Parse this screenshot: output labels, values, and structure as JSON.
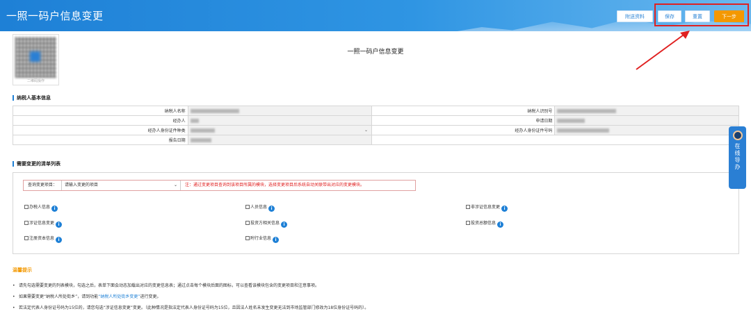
{
  "header": {
    "title": "一照一码户信息变更",
    "buttons": {
      "attach": "附送资料",
      "save": "保存",
      "reset": "重置",
      "next": "下一步"
    }
  },
  "qr": {
    "caption": "二维码操作"
  },
  "page_title": "一照一码户信息变更",
  "basic_info": {
    "section_title": "纳税人基本信息",
    "fields": {
      "taxpayer_name": "纳税人名称",
      "taxpayer_id": "纳税人识别号",
      "agent": "经办人",
      "apply_date": "申请日期",
      "agent_id_type": "经办人身份证件种类",
      "agent_id_number": "经办人身份证件号码",
      "report_date": "报告日期"
    }
  },
  "change_list": {
    "section_title": "需要变更的清单列表",
    "query_label": "查询变更项目：",
    "query_placeholder": "请输入变更的项目",
    "note": "注：通过变更项目查询到该项目所属的模块，选择变更项目后系统自动关联带出对应的变更模块。",
    "items": [
      "办税人信息",
      "人员信息",
      "非涉证信息变更",
      "涉证信息变更",
      "投资方相关信息",
      "投资总额信息",
      "注册资本信息",
      "附行业信息"
    ]
  },
  "tips": {
    "title": "温馨提示",
    "lines": [
      "请先勾选需要变更的列表模块，勾选之后，表单下面会动态加载出对应的变更信息表；通过点击每个模块后面的图标，可以查看该模块包含的变更项目和注意事项。",
      [
        "如果需要变更“纳税人所处街乡”，请到功能",
        "“纳税人所处街乡变更”",
        "进行变更。"
      ],
      "若法定代表人身份证号码为15位的，请您勾选“涉证信息变更”变更。（此种情况是指法定代表人身份证号码为15位，且因法人姓名未发生变更无法到市场监管部门修改为18位身份证号码的）。"
    ]
  },
  "side_widget": {
    "label": "在线导办"
  },
  "colors": {
    "header": "#1e80d6",
    "accent": "#f39800",
    "highlight": "#e02020"
  }
}
